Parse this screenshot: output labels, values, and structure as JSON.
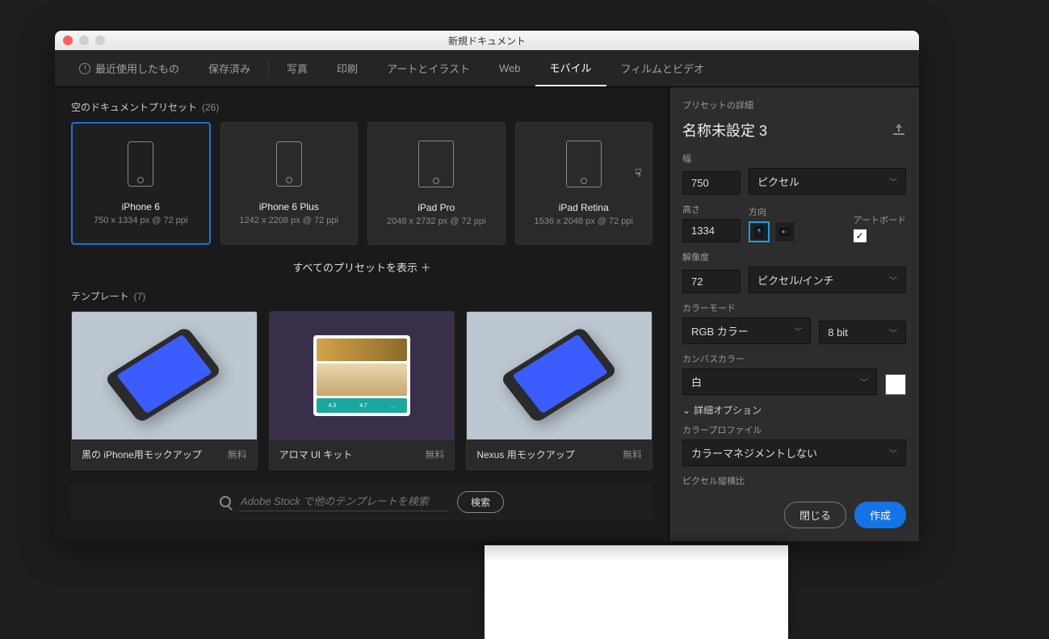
{
  "titlebar": {
    "title": "新規ドキュメント"
  },
  "tabs": {
    "recent": "最近使用したもの",
    "saved": "保存済み",
    "photo": "写真",
    "print": "印刷",
    "art": "アートとイラスト",
    "web": "Web",
    "mobile": "モバイル",
    "film": "フィルムとビデオ"
  },
  "sections": {
    "blank_presets": "空のドキュメントプリセット",
    "blank_count": "(26)",
    "show_all": "すべてのプリセットを表示 ＋",
    "templates": "テンプレート",
    "templates_count": "(7)"
  },
  "presets": [
    {
      "name": "iPhone 6",
      "dim": "750 x 1334 px @ 72 ppi"
    },
    {
      "name": "iPhone 6 Plus",
      "dim": "1242 x 2208 px @ 72 ppi"
    },
    {
      "name": "iPad Pro",
      "dim": "2048 x 2732 px @ 72 ppi"
    },
    {
      "name": "iPad Retina",
      "dim": "1536 x 2048 px @ 72 ppi"
    }
  ],
  "templates": [
    {
      "name": "黒の iPhone用モックアップ",
      "price": "無料"
    },
    {
      "name": "アロマ UI キット",
      "price": "無料"
    },
    {
      "name": "Nexus 用モックアップ",
      "price": "無料"
    }
  ],
  "search": {
    "placeholder": "Adobe Stock で他のテンプレートを検索",
    "button": "検索"
  },
  "details": {
    "header": "プリセットの詳細",
    "docname": "名称未設定 3",
    "width_label": "幅",
    "width": "750",
    "unit": "ピクセル",
    "height_label": "高さ",
    "height": "1334",
    "orient_label": "方向",
    "artboard_label": "アートボード",
    "resolution_label": "解像度",
    "resolution": "72",
    "resolution_unit": "ピクセル/インチ",
    "colormode_label": "カラーモード",
    "colormode": "RGB カラー",
    "bitdepth": "8 bit",
    "canvas_label": "カンバスカラー",
    "canvas": "白",
    "advanced": "詳細オプション",
    "profile_label": "カラープロファイル",
    "profile": "カラーマネジメントしない",
    "aspect_label": "ピクセル縦横比",
    "close": "閉じる",
    "create": "作成"
  }
}
